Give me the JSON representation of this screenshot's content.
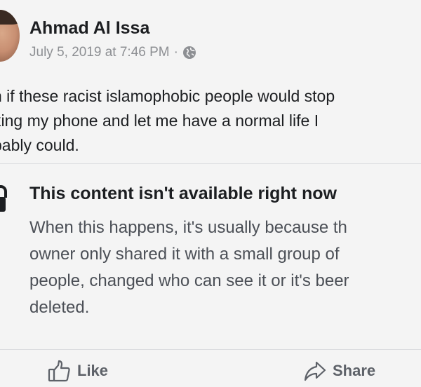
{
  "post": {
    "author": "Ahmad Al Issa",
    "timestamp": "July 5, 2019 at 7:46 PM",
    "separator": "·",
    "privacy_icon": "globe-icon",
    "text_lines": [
      "n if these racist islamophobic people would stop",
      "king my phone and let me have a normal life I",
      "bably could."
    ]
  },
  "unavailable": {
    "icon": "lock-icon",
    "title": "This content isn't available right now",
    "body_lines": [
      "When this happens, it's usually because th",
      "owner only shared it with a small group of",
      "people, changed who can see it or it's beer",
      "deleted."
    ]
  },
  "actions": {
    "like_label": "Like",
    "like_icon": "thumbs-up-icon",
    "share_label": "Share",
    "share_icon": "share-arrow-icon"
  },
  "colors": {
    "background": "#f4f4f4",
    "text": "#1c1e21",
    "meta": "#8d8f93",
    "action": "#5d6168"
  }
}
